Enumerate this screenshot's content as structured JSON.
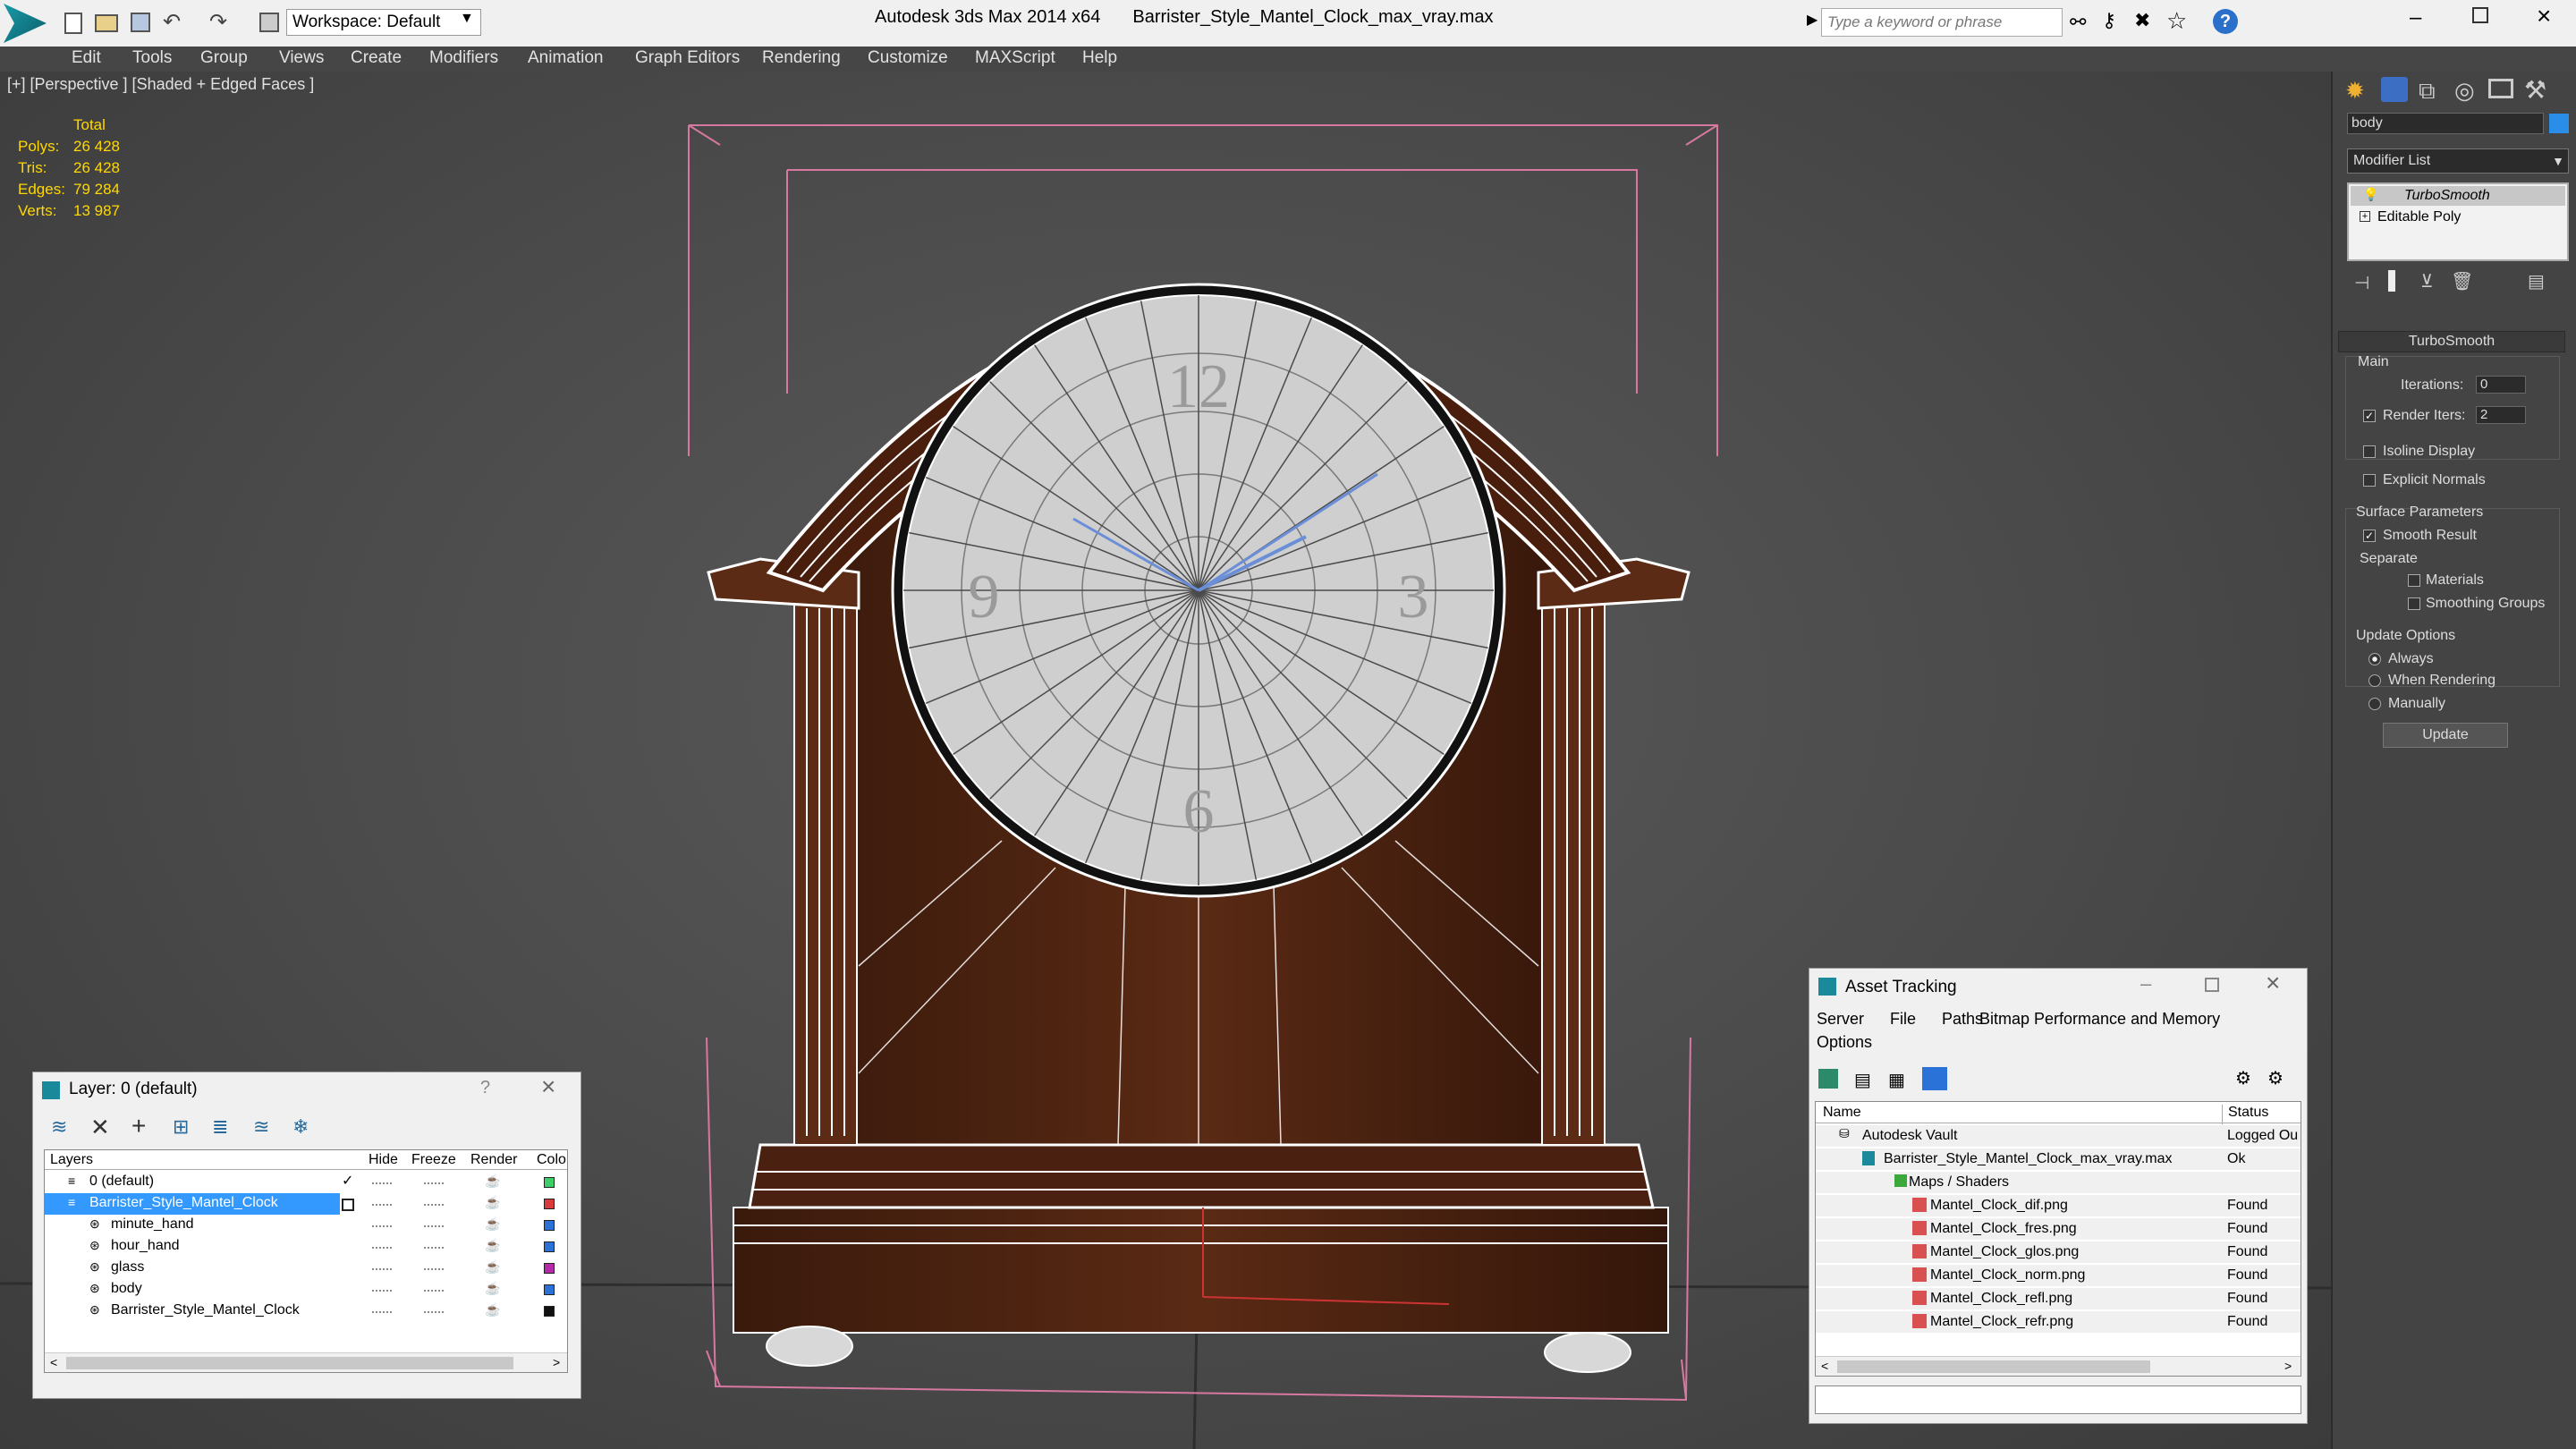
{
  "window": {
    "app_title": "Autodesk 3ds Max  2014 x64",
    "file_title": "Barrister_Style_Mantel_Clock_max_vray.max",
    "workspace": "Workspace: Default",
    "search_placeholder": "Type a keyword or phrase"
  },
  "menu": [
    "Edit",
    "Tools",
    "Group",
    "Views",
    "Create",
    "Modifiers",
    "Animation",
    "Graph Editors",
    "Rendering",
    "Customize",
    "MAXScript",
    "Help"
  ],
  "viewport": {
    "label": "[+] [Perspective ] [Shaded + Edged Faces ]",
    "stats": {
      "header": "Total",
      "rows": [
        {
          "k": "Polys:",
          "v": "26 428"
        },
        {
          "k": "Tris:",
          "v": "26 428"
        },
        {
          "k": "Edges:",
          "v": "79 284"
        },
        {
          "k": "Verts:",
          "v": "13 987"
        }
      ]
    }
  },
  "command_panel": {
    "object_name": "body",
    "modifier_list": "Modifier List",
    "stack": [
      "TurboSmooth",
      "Editable Poly"
    ],
    "rollout_title": "TurboSmooth",
    "main": "Main",
    "iterations_label": "Iterations:",
    "iterations": "0",
    "render_iters_label": "Render Iters:",
    "render_iters": "2",
    "isoline": "Isoline Display",
    "explicit": "Explicit Normals",
    "surface": "Surface Parameters",
    "smooth": "Smooth Result",
    "separate": "Separate",
    "materials": "Materials",
    "smoothing": "Smoothing Groups",
    "update_options": "Update Options",
    "always": "Always",
    "when_rendering": "When Rendering",
    "manually": "Manually",
    "update_btn": "Update"
  },
  "layer_window": {
    "title": "Layer: 0 (default)",
    "help": "?",
    "columns": [
      "Layers",
      "Hide",
      "Freeze",
      "Render",
      "Colo"
    ],
    "rows": [
      {
        "name": "0 (default)",
        "color": "#3fcf6a"
      },
      {
        "name": "Barrister_Style_Mantel_Clock",
        "color": "#d83b3b"
      },
      {
        "name": "minute_hand",
        "color": "#2a72d8"
      },
      {
        "name": "hour_hand",
        "color": "#2a72d8"
      },
      {
        "name": "glass",
        "color": "#b42aa8"
      },
      {
        "name": "body",
        "color": "#2a72d8"
      },
      {
        "name": "Barrister_Style_Mantel_Clock",
        "color": "#111111"
      }
    ]
  },
  "asset_window": {
    "title": "Asset Tracking",
    "menu": [
      "Server",
      "File",
      "Paths",
      "Bitmap Performance and Memory"
    ],
    "menu2": "Options",
    "columns": [
      "Name",
      "Status"
    ],
    "rows": [
      {
        "name": "Autodesk Vault",
        "status": "Logged Ou"
      },
      {
        "name": "Barrister_Style_Mantel_Clock_max_vray.max",
        "status": "Ok"
      },
      {
        "name": "Maps / Shaders",
        "status": ""
      },
      {
        "name": "Mantel_Clock_dif.png",
        "status": "Found"
      },
      {
        "name": "Mantel_Clock_fres.png",
        "status": "Found"
      },
      {
        "name": "Mantel_Clock_glos.png",
        "status": "Found"
      },
      {
        "name": "Mantel_Clock_norm.png",
        "status": "Found"
      },
      {
        "name": "Mantel_Clock_refl.png",
        "status": "Found"
      },
      {
        "name": "Mantel_Clock_refr.png",
        "status": "Found"
      }
    ]
  }
}
